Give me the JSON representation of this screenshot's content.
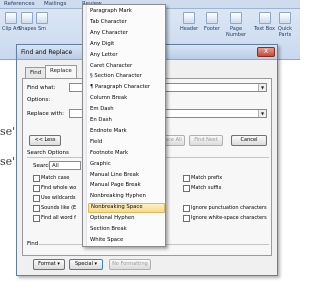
{
  "ribbon": {
    "tabs": [
      "References",
      "Mailings",
      "Review"
    ],
    "groups": [
      "Clip Art",
      "Shapes",
      "Sm",
      "Header",
      "Footer",
      "Page Number",
      "Text Box",
      "Quick Parts"
    ]
  },
  "document": {
    "fragments": [
      "se'",
      "se'"
    ]
  },
  "dialog": {
    "title": "Find and Replace",
    "close_label": "X",
    "tabs": [
      "Find",
      "Replace"
    ],
    "find_what_label": "Find what:",
    "options_label": "Options:",
    "replace_with_label": "Replace with:",
    "less_button": "<< Less",
    "replace_all_button": "Replace All",
    "find_next_button": "Find Next",
    "cancel_button": "Cancel",
    "search_options_label": "Search Options",
    "search_label": "Search:",
    "search_value": "All",
    "checkboxes_left": [
      "Match case",
      "Find whole wo",
      "Use wildcards",
      "Sounds like (E",
      "Find all word f"
    ],
    "checkboxes_right": [
      "Match prefix",
      "Match suffix",
      "Ignore punctuation characters",
      "Ignore white-space characters"
    ],
    "find_section_label": "Find",
    "format_button": "Format",
    "special_button": "Special",
    "no_formatting_button": "No Formatting"
  },
  "special_menu": {
    "items": [
      "Paragraph Mark",
      "Tab Character",
      "Any Character",
      "Any Digit",
      "Any Letter",
      "Caret Character",
      "§ Section Character",
      "¶ Paragraph Character",
      "Column Break",
      "Em Dash",
      "En Dash",
      "Endnote Mark",
      "Field",
      "Footnote Mark",
      "Graphic",
      "Manual Line Break",
      "Manual Page Break",
      "Nonbreaking Hyphen",
      "Nonbreaking Space",
      "Optional Hyphen",
      "Section Break",
      "White Space"
    ],
    "highlighted_index": 18
  }
}
